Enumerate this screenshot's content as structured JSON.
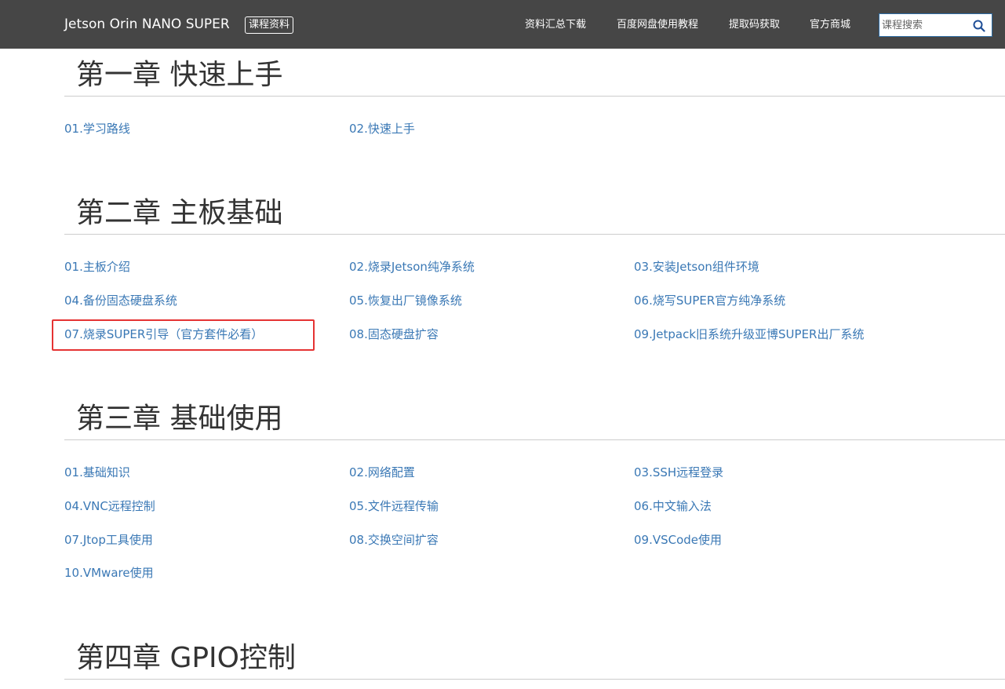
{
  "header": {
    "brand": "Jetson Orin NANO SUPER",
    "badge": "课程资料",
    "nav": [
      "资料汇总下载",
      "百度网盘使用教程",
      "提取码获取",
      "官方商城"
    ],
    "search": {
      "placeholder": "课程搜索",
      "icon": "search-icon"
    }
  },
  "chapters": [
    {
      "title": "第一章 快速上手",
      "lessons": [
        "01.学习路线",
        "02.快速上手"
      ]
    },
    {
      "title": "第二章 主板基础",
      "lessons": [
        "01.主板介绍",
        "02.烧录Jetson纯净系统",
        "03.安装Jetson组件环境",
        "04.备份固态硬盘系统",
        "05.恢复出厂镜像系统",
        "06.烧写SUPER官方纯净系统",
        "07.烧录SUPER引导（官方套件必看）",
        "08.固态硬盘扩容",
        "09.Jetpack旧系统升级亚博SUPER出厂系统"
      ]
    },
    {
      "title": "第三章 基础使用",
      "lessons": [
        "01.基础知识",
        "02.网络配置",
        "03.SSH远程登录",
        "04.VNC远程控制",
        "05.文件远程传输",
        "06.中文输入法",
        "07.Jtop工具使用",
        "08.交换空间扩容",
        "09.VSCode使用",
        "10.VMware使用"
      ]
    },
    {
      "title": "第四章 GPIO控制",
      "lessons": []
    }
  ],
  "colors": {
    "header_bg": "#464646",
    "link": "#3a78b5",
    "title": "#333333",
    "rule": "#cccccc",
    "highlight": "#e53333"
  }
}
